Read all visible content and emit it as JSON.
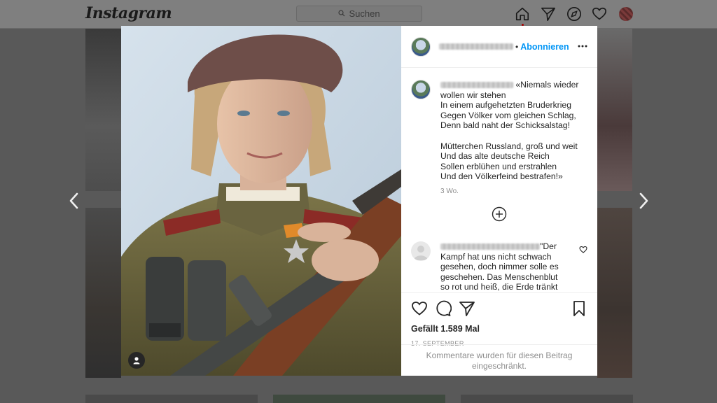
{
  "app": {
    "logo_text": "Instagram"
  },
  "search": {
    "placeholder": "Suchen",
    "icon": "search-icon"
  },
  "nav": {
    "icons": [
      "home-icon",
      "direct-icon",
      "explore-icon",
      "activity-heart-icon",
      "profile-avatar"
    ]
  },
  "post": {
    "header": {
      "follow_label": "Abonnieren",
      "separator": "•",
      "more_icon": "more-options-icon"
    },
    "caption": {
      "text": "«Niemals wieder wollen wir stehen\nIn einem aufgehetzten Bruderkrieg\nGegen Völker vom gleichen Schlag,\nDenn bald naht der Schicksalstag!\n\nMütterchen Russland, groß und weit\nUnd das alte deutsche Reich\nSollen erblühen und erstrahlen\nUnd den Völkerfeind bestrafen!»",
      "time": "3 Wo."
    },
    "load_more_icon": "plus-circle-icon",
    "comment": {
      "text": "\"Der Kampf hat uns nicht schwach gesehen, doch nimmer solle es geschehen. Das Menschenblut so rot und heiß, die Erde tränkt als"
    },
    "actions": {
      "icons": [
        "like-heart-icon",
        "comment-icon",
        "share-icon",
        "save-bookmark-icon"
      ]
    },
    "likes": "Gefällt 1.589 Mal",
    "date": "17. SEPTEMBER",
    "comments_limited": "Kommentare wurden für diesen Beitrag eingeschränkt."
  },
  "colors": {
    "accent": "#0095f6",
    "overlay": "#595959",
    "text": "#262626",
    "muted": "#8e8e8e"
  }
}
